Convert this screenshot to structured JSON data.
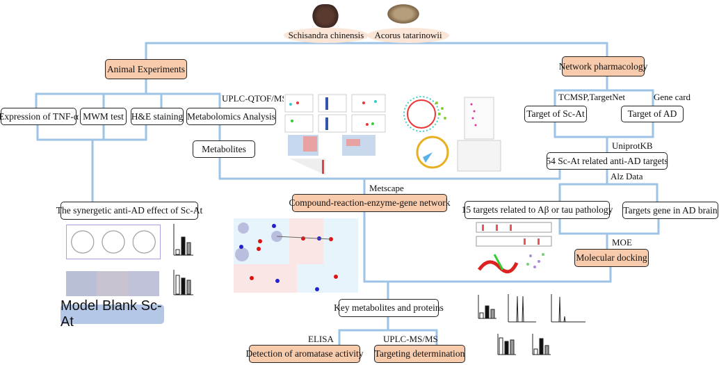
{
  "herbs": {
    "herb1": "Schisandra chinensis",
    "herb2": "Acorus tatarinowii"
  },
  "left": {
    "animal": "Animal Experiments",
    "tnf": "Expression of TNF-α",
    "mwm": "MWM test",
    "he": "H&E staining",
    "metabolomics": "Metabolomics Analysis",
    "uplc_qtof": "UPLC-QTOF/MS",
    "metabolites": "Metabolites",
    "synergetic": "The synergetic anti-AD effect of Sc-At",
    "groups": "Model Blank Sc-At"
  },
  "right": {
    "network": "Network pharmacology",
    "tcmsp": "TCMSP,TargetNet",
    "genecard": "Gene card",
    "target_scat": "Target of Sc-At",
    "target_ad": "Target of AD",
    "uniprot": "UniprotKB",
    "targets54": "54 Sc-At related anti-AD targets",
    "alzdata": "Alz Data",
    "targets15": "15 targets related to Aβ or tau pathology",
    "targets_brain": "Targets gene in AD brain",
    "moe": "MOE",
    "docking": "Molecular docking"
  },
  "center": {
    "metscape": "Metscape",
    "compound": "Compound-reaction-enzyme-gene network",
    "key": "Key metabolites and proteins",
    "elisa": "ELISA",
    "uplc_msms": "UPLC-MS/MS",
    "aromatase": "Detection of aromatase activity",
    "targeting": "Targeting determination"
  },
  "colors": {
    "connector": "#9dc3e6",
    "highlight_box": "#f8cbad",
    "herb_label": "#fbe5d6",
    "group_label": "#b4c7e7"
  }
}
